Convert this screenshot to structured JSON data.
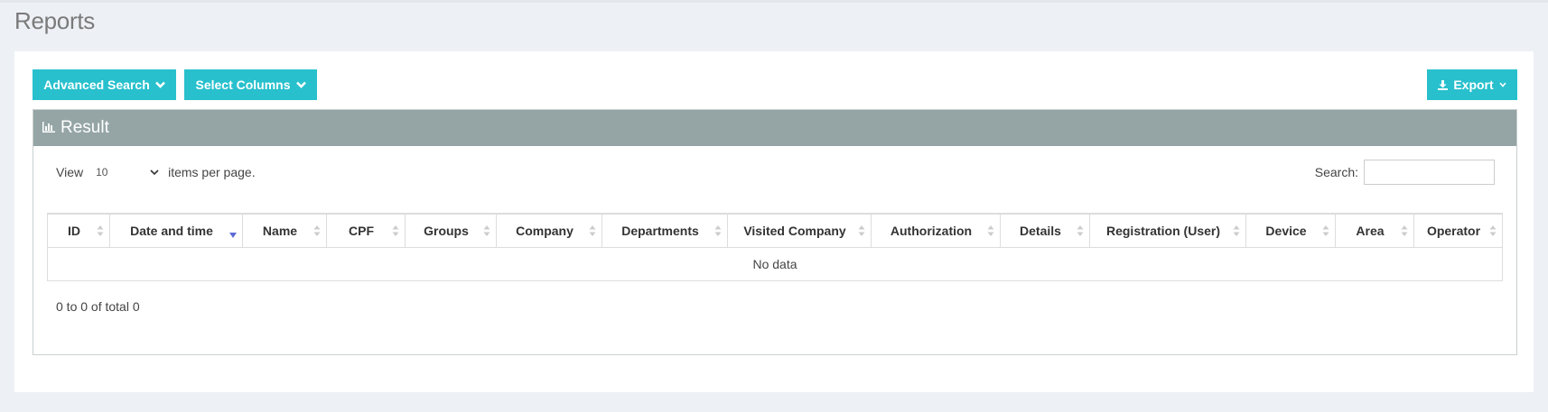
{
  "page": {
    "title": "Reports"
  },
  "toolbar": {
    "advanced_search_label": "Advanced Search",
    "select_columns_label": "Select Columns",
    "export_label": "Export"
  },
  "result": {
    "title": "Result",
    "view_label": "View",
    "page_size": "10",
    "items_suffix": "items per page.",
    "search_label": "Search:",
    "search_value": "",
    "columns": [
      "ID",
      "Date and time",
      "Name",
      "CPF",
      "Groups",
      "Company",
      "Departments",
      "Visited Company",
      "Authorization",
      "Details",
      "Registration (User)",
      "Device",
      "Area",
      "Operator"
    ],
    "sorted_column": "Date and time",
    "empty_text": "No data",
    "pager_text": "0 to 0 of total 0"
  },
  "colors": {
    "accent": "#28c0cd",
    "header_bg": "#95a5a6",
    "sort_active": "#5b6bd8"
  }
}
